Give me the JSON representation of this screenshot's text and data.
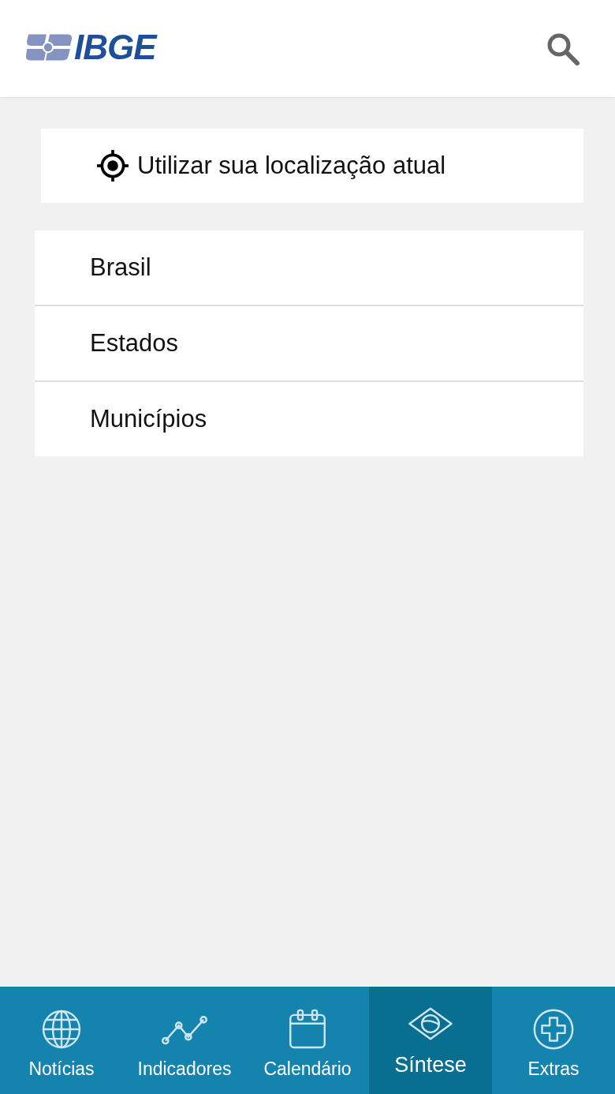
{
  "header": {
    "logo_text": "IBGE"
  },
  "location_button": {
    "label": "Utilizar sua localização atual"
  },
  "levels": [
    {
      "label": "Brasil"
    },
    {
      "label": "Estados"
    },
    {
      "label": "Municípios"
    }
  ],
  "tabs": [
    {
      "label": "Notícias",
      "kind": "globe",
      "selected": false
    },
    {
      "label": "Indicadores",
      "kind": "line",
      "selected": false
    },
    {
      "label": "Calendário",
      "kind": "calendar",
      "selected": false
    },
    {
      "label": "Síntese",
      "kind": "flag",
      "selected": true
    },
    {
      "label": "Extras",
      "kind": "plus",
      "selected": false
    }
  ]
}
